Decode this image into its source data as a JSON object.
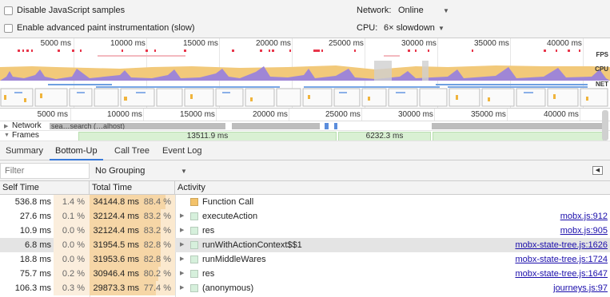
{
  "settings": {
    "disable_js_samples": "Disable JavaScript samples",
    "advanced_paint": "Enable advanced paint instrumentation (slow)",
    "network_label": "Network:",
    "network_value": "Online",
    "cpu_label": "CPU:",
    "cpu_value": "6× slowdown"
  },
  "overview": {
    "ticks": [
      "5000 ms",
      "10000 ms",
      "15000 ms",
      "20000 ms",
      "25000 ms",
      "30000 ms",
      "35000 ms",
      "40000 ms"
    ],
    "fps_label": "FPS",
    "cpu_label": "CPU",
    "net_label": "NET"
  },
  "ruler": {
    "ticks": [
      "5000 ms",
      "10000 ms",
      "15000 ms",
      "20000 ms",
      "25000 ms",
      "30000 ms",
      "35000 ms",
      "40000 ms"
    ]
  },
  "tracks": {
    "network_label": "Network",
    "network_bar_text": "sea…search (…alhost)",
    "frames_label": "Frames",
    "frame_1": "13511.9 ms",
    "frame_2": "6232.3 ms"
  },
  "tabs": [
    "Summary",
    "Bottom-Up",
    "Call Tree",
    "Event Log"
  ],
  "active_tab": "Bottom-Up",
  "filter": {
    "placeholder": "Filter",
    "grouping": "No Grouping"
  },
  "table": {
    "headers": [
      "Self Time",
      "Total Time",
      "Activity"
    ],
    "rows": [
      {
        "self_ms": "536.8 ms",
        "self_pct": "1.4 %",
        "total_ms": "34144.8 ms",
        "total_pct": "88.4 %",
        "total_frac": 0.884,
        "activity": "Function Call",
        "color": "#f3c26a",
        "link": "",
        "expandable": false
      },
      {
        "self_ms": "27.6 ms",
        "self_pct": "0.1 %",
        "total_ms": "32124.4 ms",
        "total_pct": "83.2 %",
        "total_frac": 0.832,
        "activity": "executeAction",
        "color": "#d6f0dc",
        "link": "mobx.js:912",
        "expandable": true
      },
      {
        "self_ms": "10.9 ms",
        "self_pct": "0.0 %",
        "total_ms": "32124.4 ms",
        "total_pct": "83.2 %",
        "total_frac": 0.832,
        "activity": "res",
        "color": "#d6f0dc",
        "link": "mobx.js:905",
        "expandable": true
      },
      {
        "self_ms": "6.8 ms",
        "self_pct": "0.0 %",
        "total_ms": "31954.5 ms",
        "total_pct": "82.8 %",
        "total_frac": 0.828,
        "activity": "runWithActionContext$$1",
        "color": "#d6f0dc",
        "link": "mobx-state-tree.js:1626",
        "expandable": true
      },
      {
        "self_ms": "18.8 ms",
        "self_pct": "0.0 %",
        "total_ms": "31953.6 ms",
        "total_pct": "82.8 %",
        "total_frac": 0.828,
        "activity": "runMiddleWares",
        "color": "#d6f0dc",
        "link": "mobx-state-tree.js:1724",
        "expandable": true
      },
      {
        "self_ms": "75.7 ms",
        "self_pct": "0.2 %",
        "total_ms": "30946.4 ms",
        "total_pct": "80.2 %",
        "total_frac": 0.802,
        "activity": "res",
        "color": "#d6f0dc",
        "link": "mobx-state-tree.js:1647",
        "expandable": true
      },
      {
        "self_ms": "106.3 ms",
        "self_pct": "0.3 %",
        "total_ms": "29873.3 ms",
        "total_pct": "77.4 %",
        "total_frac": 0.774,
        "activity": "(anonymous)",
        "color": "#d6f0dc",
        "link": "journeys.js:97",
        "expandable": true
      }
    ],
    "selected_row": 3
  }
}
